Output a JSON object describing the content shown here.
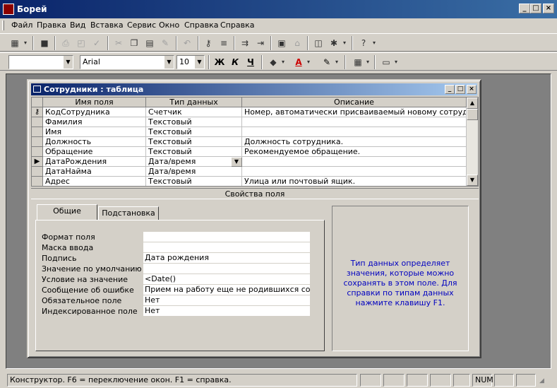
{
  "app": {
    "title": "Борей"
  },
  "menu": [
    "Файл",
    "Правка",
    "Вид",
    "Вставка",
    "Сервис",
    "Окно",
    "Справка",
    "Справка"
  ],
  "format_toolbar": {
    "font_name": "Arial",
    "font_size": "10",
    "bold": "Ж",
    "italic": "К",
    "underline": "Ч",
    "text_color_letter": "A"
  },
  "document": {
    "title": "Сотрудники : таблица",
    "columns": [
      "Имя поля",
      "Тип данных",
      "Описание"
    ],
    "rows": [
      {
        "name": "КодСотрудника",
        "type": "Счетчик",
        "description": "Номер, автоматически присваиваемый новому сотруднику.",
        "key": true
      },
      {
        "name": "Фамилия",
        "type": "Текстовый",
        "description": ""
      },
      {
        "name": "Имя",
        "type": "Текстовый",
        "description": ""
      },
      {
        "name": "Должность",
        "type": "Текстовый",
        "description": "Должность сотрудника."
      },
      {
        "name": "Обращение",
        "type": "Текстовый",
        "description": "Рекомендуемое обращение."
      },
      {
        "name": "ДатаРождения",
        "type": "Дата/время",
        "description": "",
        "current": true
      },
      {
        "name": "ДатаНайма",
        "type": "Дата/время",
        "description": ""
      },
      {
        "name": "Адрес",
        "type": "Текстовый",
        "description": "Улица или почтовый ящик."
      }
    ],
    "properties_header": "Свойства поля",
    "tabs": [
      "Общие",
      "Подстановка"
    ],
    "properties": [
      {
        "label": "Формат поля",
        "value": ""
      },
      {
        "label": "Маска ввода",
        "value": ""
      },
      {
        "label": "Подпись",
        "value": "Дата рождения"
      },
      {
        "label": "Значение по умолчанию",
        "value": ""
      },
      {
        "label": "Условие на значение",
        "value": "<Date()"
      },
      {
        "label": "Сообщение об ошибке",
        "value": "Прием на работу еще не родившихся сотру"
      },
      {
        "label": "Обязательное поле",
        "value": "Нет"
      },
      {
        "label": "Индексированное поле",
        "value": "Нет"
      }
    ],
    "help_text": "Тип данных определяет значения, которые можно сохранять в этом поле.  Для справки по типам данных нажмите клавишу F1."
  },
  "status": {
    "text": "Конструктор.  F6 = переключение окон.  F1 = справка.",
    "num": "NUM"
  },
  "colors": {
    "titlebar": "#0a246a",
    "help_text": "#0000c0"
  }
}
